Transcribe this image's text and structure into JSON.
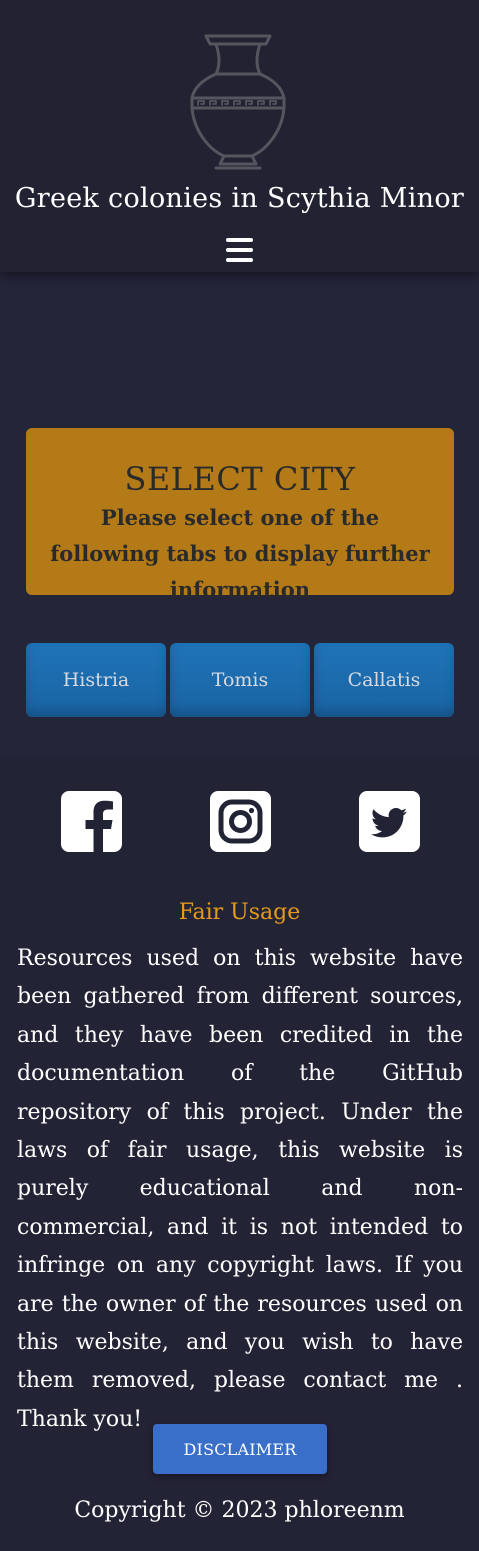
{
  "header": {
    "logo_icon": "greek-amphora-icon",
    "title": "Greek colonies in Scythia Minor",
    "menu_icon": "hamburger-menu-icon"
  },
  "select_card": {
    "title": "SELECT CITY",
    "text": "Please select one of the following tabs to display further information"
  },
  "tabs": [
    {
      "label": "Histria"
    },
    {
      "label": "Tomis"
    },
    {
      "label": "Callatis"
    }
  ],
  "footer": {
    "social_icons": [
      "facebook-icon",
      "instagram-icon",
      "twitter-icon"
    ],
    "fair_usage_title": "Fair Usage",
    "fair_usage_text": "Resources used on this website have been gathered from different sources, and they have been credited in the documentation of the GitHub repository of this project. Under the laws of fair usage, this website is purely educational and non-commercial, and it is not intended to infringe on any copyright laws. If you are the owner of the resources used on this website, and you wish to have them removed, please contact me . Thank you!",
    "disclaimer_label": "DISCLAIMER",
    "copyright": "Copyright © 2023 phloreenm"
  },
  "colors": {
    "page_bg": "#25253a",
    "header_bg": "#222232",
    "card_bg": "#b47a17",
    "tab_bg": "#1e74b8",
    "accent": "#e49a1b",
    "button_bg": "#3a6fc9"
  }
}
